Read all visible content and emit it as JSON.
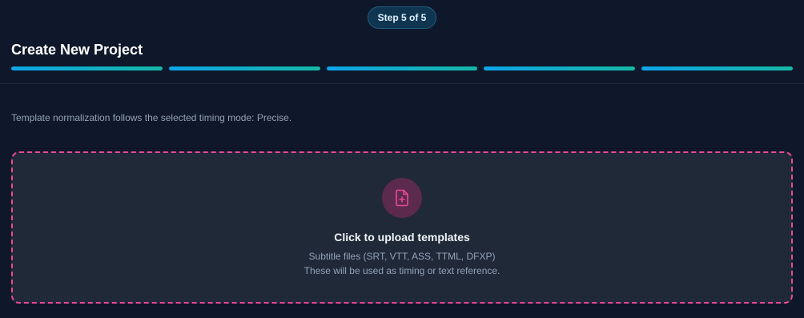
{
  "header": {
    "step_label": "Step 5 of 5",
    "title": "Create New Project",
    "progress": {
      "total_steps": 5,
      "completed_steps": 5
    }
  },
  "main": {
    "info_text": "Template normalization follows the selected timing mode: Precise.",
    "dropzone": {
      "icon": "file-plus-icon",
      "title": "Click to upload templates",
      "subtitle_line1": "Subtitle files (SRT, VTT, ASS, TTML, DFXP)",
      "subtitle_line2": "These will be used as timing or text reference."
    }
  },
  "colors": {
    "background": "#0f172a",
    "accent_start": "#0ea5e9",
    "accent_end": "#14b8a6",
    "dropzone_border": "#ec4899",
    "icon_color": "#ec4899"
  }
}
